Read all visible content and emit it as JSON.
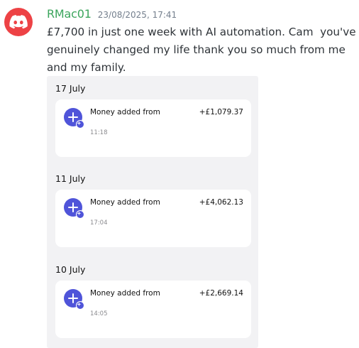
{
  "author": {
    "username": "RMac01",
    "timestamp": "23/08/2025, 17:41",
    "avatar_icon": "discord-logo-icon",
    "avatar_color": "#ed4245",
    "name_color": "#3ba55c"
  },
  "message": {
    "text": "£7,700 in just one week with AI automation. Cam  you've genuinely changed my life thank you so much from me and my family."
  },
  "attachment": {
    "groups": [
      {
        "date": "17 July",
        "transaction": {
          "icon": "add-money-icon",
          "title": "Money added from",
          "amount": "+£1,079.37",
          "time": "11:18"
        }
      },
      {
        "date": "11 July",
        "transaction": {
          "icon": "add-money-icon",
          "title": "Money added from",
          "amount": "+£4,062.13",
          "time": "17:04"
        }
      },
      {
        "date": "10 July",
        "transaction": {
          "icon": "add-money-icon",
          "title": "Money added from",
          "amount": "+£2,669.14",
          "time": "14:05"
        }
      }
    ],
    "accent_color": "#4f54d9"
  }
}
